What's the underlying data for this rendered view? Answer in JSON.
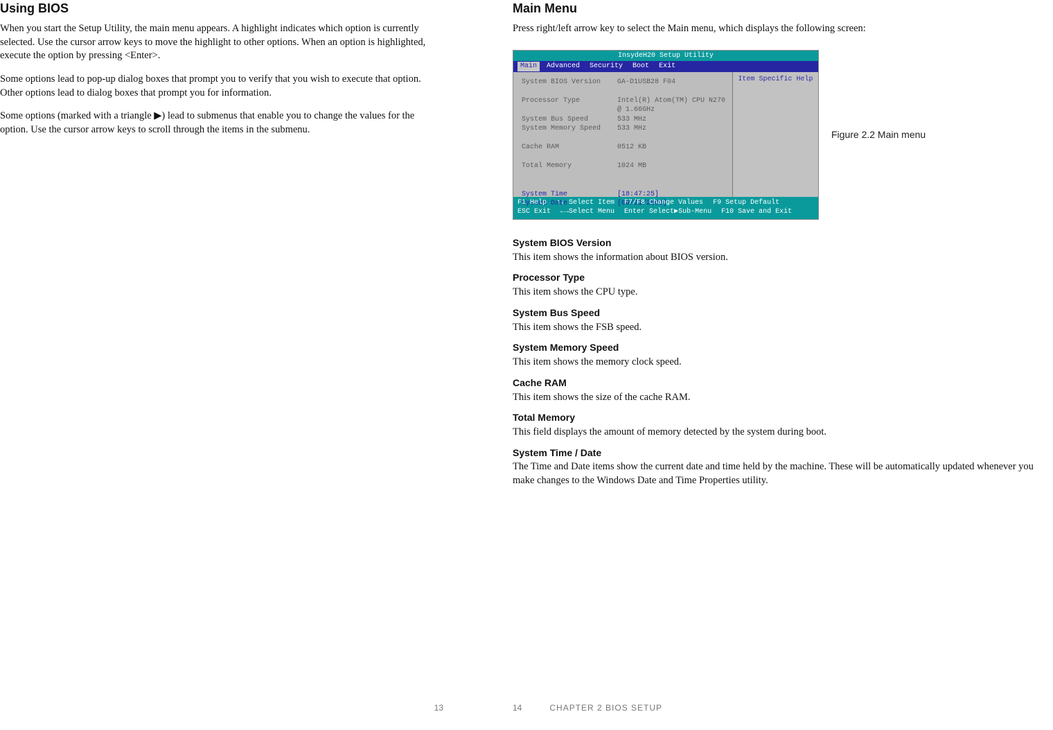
{
  "left": {
    "heading": "Using BIOS",
    "p1": "When you start the Setup Utility, the main menu appears. A highlight indicates which option is currently selected. Use the cursor arrow keys to move the highlight to other options. When an option is highlighted, execute the option by pressing <Enter>.",
    "p2": "Some options lead to pop-up dialog boxes that prompt you to verify that you wish to execute that option. Other options lead to dialog boxes that prompt you for information.",
    "p3": "Some options (marked with a triangle ▶) lead to submenus that enable you to change the values for the option. Use the cursor arrow keys to scroll through the items in the submenu."
  },
  "right": {
    "heading": "Main Menu",
    "p1": "Press right/left arrow key to select the Main menu, which displays the following screen:",
    "figure_label": "Figure 2.2 Main menu",
    "items": [
      {
        "h": "System BIOS Version",
        "p": "This item shows the information about BIOS version."
      },
      {
        "h": "Processor Type",
        "p": "This item shows the CPU type."
      },
      {
        "h": "System Bus Speed",
        "p": "This item shows the FSB speed."
      },
      {
        "h": "System Memory Speed",
        "p": "This item shows the memory clock speed."
      },
      {
        "h": "Cache RAM",
        "p": "This item shows the size of the cache RAM."
      },
      {
        "h": "Total Memory",
        "p": "This field displays the amount of memory detected by the system during boot."
      },
      {
        "h": "System Time / Date",
        "p": "The Time and Date items show the current date and time held by the machine. These will be automatically updated whenever you make changes to the Windows Date and Time Properties utility."
      }
    ]
  },
  "bios": {
    "title": "InsydeH20 Setup Utility",
    "tabs": [
      "Main",
      "Advanced",
      "Security",
      "Boot",
      "Exit"
    ],
    "help_title": "Item Specific Help",
    "rows": {
      "bios_ver_l": "System BIOS Version",
      "bios_ver_v": "GA-D1USB28 F04",
      "proc_l": "Processor Type",
      "proc_v1": "Intel(R) Atom(TM) CPU N270",
      "proc_v2": "@ 1.66GHz",
      "bus_l": "System Bus Speed",
      "bus_v": "533 MHz",
      "mem_spd_l": "System Memory Speed",
      "mem_spd_v": "533 MHz",
      "cache_l": "Cache RAM",
      "cache_v": "0512 KB",
      "tot_l": "Total Memory",
      "tot_v": "1024 MB",
      "time_l": "System Time",
      "time_v": "[18:47:25]",
      "date_l": "System Date",
      "date_v": "[06/21/2009]"
    },
    "footer": {
      "l1a": "F1 Help",
      "l1b": "↑↓ Select Item",
      "l1c": "F7/F8 Change Values",
      "l1d": "F9 Setup Default",
      "l2a": "ESC Exit",
      "l2b": "←→Select Menu",
      "l2c": "Enter Select▶Sub-Menu",
      "l2d": "F10 Save and Exit"
    }
  },
  "footer": {
    "left_page": "13",
    "right_page": "14",
    "right_chapter": "CHAPTER 2 BIOS SETUP"
  }
}
